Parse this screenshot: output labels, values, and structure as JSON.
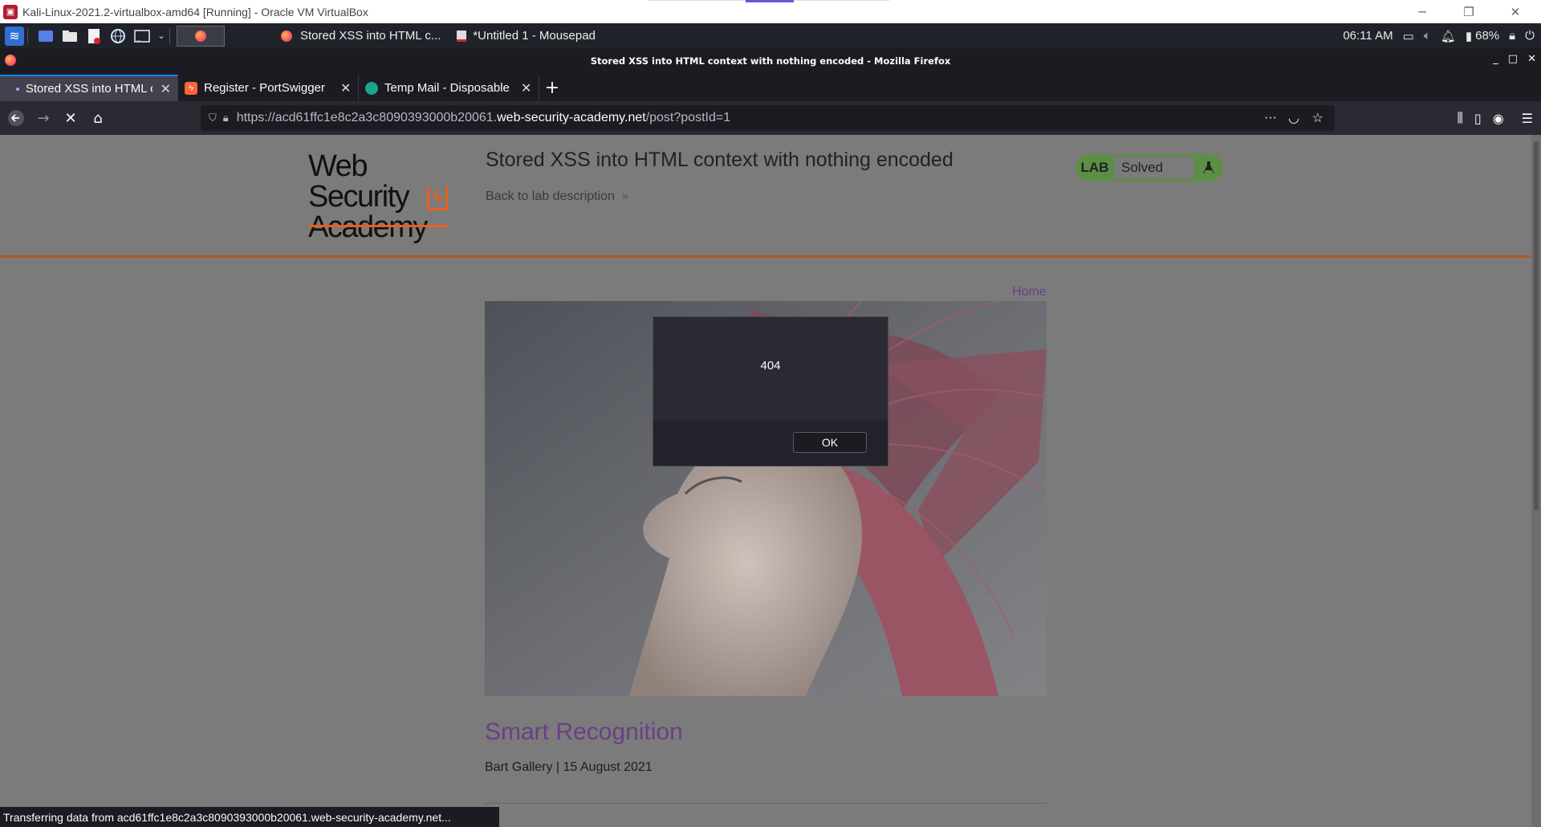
{
  "vbox": {
    "title": "Kali-Linux-2021.2-virtualbox-amd64 [Running] - Oracle VM VirtualBox",
    "minimize": "─",
    "restore": "❐",
    "close": "✕"
  },
  "panel": {
    "tasks": [
      {
        "label": "Stored XSS into HTML c...",
        "icon": "firefox-icon"
      },
      {
        "label": "*Untitled 1 - Mousepad",
        "icon": "mousepad-icon"
      }
    ],
    "time": "06:11 AM",
    "battery": "68%"
  },
  "firefox": {
    "window_title": "Stored XSS into HTML context with nothing encoded - Mozilla Firefox",
    "tabs": [
      {
        "label": "Stored XSS into HTML co",
        "active": true,
        "icon_color": "#2b2a33"
      },
      {
        "label": "Register - PortSwigger",
        "active": false,
        "icon_color": "#ff6633"
      },
      {
        "label": "Temp Mail - Disposable T",
        "active": false,
        "icon_color": "#1aa58c"
      }
    ],
    "url_prefix": "https://acd61ffc1e8c2a3c8090393000b20061.",
    "url_host": "web-security-academy.net",
    "url_path": "/post?postId=1"
  },
  "page": {
    "logo_line1": "Web Security",
    "logo_line2": "Academy",
    "lab_title": "Stored XSS into HTML context with nothing encoded",
    "back_link": "Back to lab description",
    "back_chevrons": "»",
    "lab_tag": "LAB",
    "lab_status": "Solved",
    "home_link": "Home",
    "post_title": "Smart Recognition",
    "post_meta": "Bart Gallery | 15 August 2021",
    "status_bar": "Transferring data from acd61ffc1e8c2a3c8090393000b20061.web-security-academy.net..."
  },
  "alert": {
    "message": "404",
    "ok_label": "OK"
  }
}
